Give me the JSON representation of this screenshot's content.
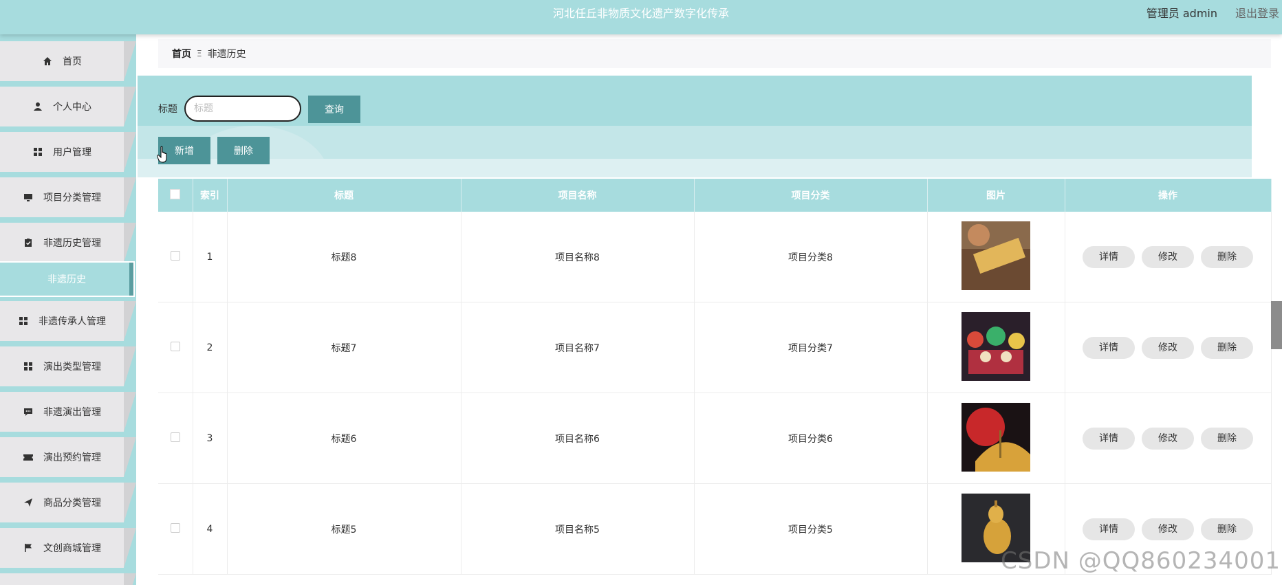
{
  "header": {
    "title": "河北任丘非物质文化遗产数字化传承",
    "user": "管理员 admin",
    "logout": "退出登录"
  },
  "sidebar": {
    "items": [
      {
        "label": "首页",
        "icon": "home-icon"
      },
      {
        "label": "个人中心",
        "icon": "user-icon"
      },
      {
        "label": "用户管理",
        "icon": "grid-icon"
      },
      {
        "label": "项目分类管理",
        "icon": "monitor-icon"
      },
      {
        "label": "非遗历史管理",
        "icon": "clipboard-icon"
      },
      {
        "label": "非遗传承人管理",
        "icon": "grid-icon"
      },
      {
        "label": "演出类型管理",
        "icon": "grid-icon"
      },
      {
        "label": "非遗演出管理",
        "icon": "chat-icon"
      },
      {
        "label": "演出预约管理",
        "icon": "ticket-icon"
      },
      {
        "label": "商品分类管理",
        "icon": "send-icon"
      },
      {
        "label": "文创商城管理",
        "icon": "flag-icon"
      }
    ],
    "active_sub": "非遗历史"
  },
  "breadcrumb": {
    "home": "首页",
    "separator": "Ξ",
    "current": "非遗历史"
  },
  "search": {
    "label": "标题",
    "placeholder": "标题",
    "query_button": "查询"
  },
  "actions": {
    "add": "新增",
    "delete": "删除"
  },
  "table": {
    "headers": [
      "索引",
      "标题",
      "项目名称",
      "项目分类",
      "图片",
      "操作"
    ],
    "rows": [
      {
        "index": "1",
        "title": "标题8",
        "name": "项目名称8",
        "category": "项目分类8"
      },
      {
        "index": "2",
        "title": "标题7",
        "name": "项目名称7",
        "category": "项目分类7"
      },
      {
        "index": "3",
        "title": "标题6",
        "name": "项目名称6",
        "category": "项目分类6"
      },
      {
        "index": "4",
        "title": "标题5",
        "name": "项目名称5",
        "category": "项目分类5"
      }
    ],
    "row_actions": {
      "detail": "详情",
      "edit": "修改",
      "delete": "删除"
    }
  },
  "watermark": "CSDN @QQ860234001",
  "colors": {
    "accent": "#a7dcde",
    "button": "#4d9498",
    "menu_face": "#e8e7e9"
  }
}
